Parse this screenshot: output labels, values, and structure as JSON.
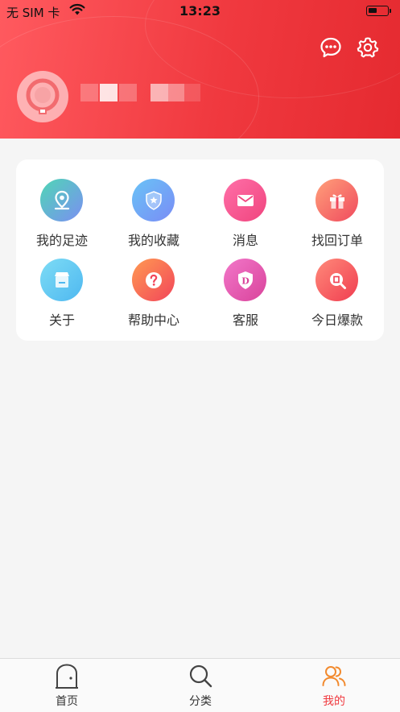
{
  "status_bar": {
    "carrier": "无 SIM 卡",
    "time": "13:23"
  },
  "header": {
    "icons": [
      "message-icon",
      "gear-icon"
    ],
    "avatar": "avatar-icon"
  },
  "menu": {
    "items": [
      {
        "label": "我的足迹",
        "icon": "location-pin-icon",
        "color_from": "#4fd6b5",
        "color_to": "#7b8ff2"
      },
      {
        "label": "我的收藏",
        "icon": "star-shield-icon",
        "color_from": "#69c3f7",
        "color_to": "#7a8cf5"
      },
      {
        "label": "消息",
        "icon": "envelope-icon",
        "color_from": "#ff6fa8",
        "color_to": "#f0457e"
      },
      {
        "label": "找回订单",
        "icon": "gift-icon",
        "color_from": "#ffa07a",
        "color_to": "#f04a5e"
      },
      {
        "label": "关于",
        "icon": "store-icon",
        "color_from": "#7ddcf5",
        "color_to": "#4fb8f0"
      },
      {
        "label": "帮助中心",
        "icon": "question-icon",
        "color_from": "#ff9a52",
        "color_to": "#f2455a"
      },
      {
        "label": "客服",
        "icon": "d-shield-icon",
        "color_from": "#f277c9",
        "color_to": "#d9439b"
      },
      {
        "label": "今日爆款",
        "icon": "search-doc-icon",
        "color_from": "#ff8a7a",
        "color_to": "#f03d50"
      }
    ]
  },
  "tabbar": {
    "tabs": [
      {
        "label": "首页",
        "icon": "home-icon",
        "active": false
      },
      {
        "label": "分类",
        "icon": "search-icon",
        "active": false
      },
      {
        "label": "我的",
        "icon": "user-group-icon",
        "active": true
      }
    ],
    "active_color": "#f0393f"
  }
}
